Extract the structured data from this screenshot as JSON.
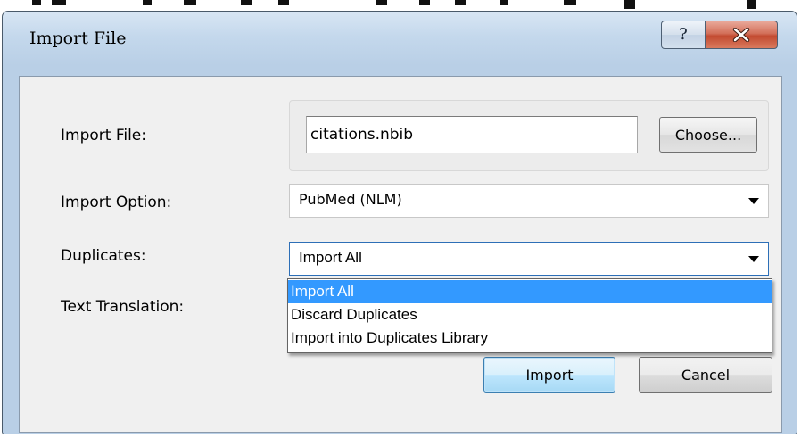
{
  "window": {
    "title": "Import File",
    "help_glyph": "?",
    "close_icon": "close-icon"
  },
  "form": {
    "import_file_label": "Import File:",
    "import_file_value": "citations.nbib",
    "choose_button": "Choose...",
    "import_option_label": "Import Option:",
    "import_option_value": "PubMed (NLM)",
    "duplicates_label": "Duplicates:",
    "duplicates_value": "Import All",
    "text_translation_label": "Text Translation:"
  },
  "dropdown": {
    "items": [
      {
        "label": "Import All",
        "selected": true
      },
      {
        "label": "Discard Duplicates",
        "selected": false
      },
      {
        "label": "Import into Duplicates Library",
        "selected": false
      }
    ]
  },
  "buttons": {
    "import": "Import",
    "cancel": "Cancel"
  },
  "colors": {
    "selection": "#3399ff",
    "close_button": "#c24a30",
    "title_bar": "#c4d8ec"
  }
}
